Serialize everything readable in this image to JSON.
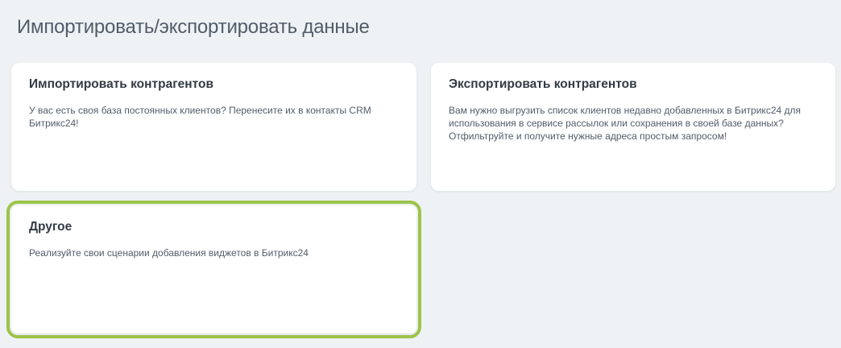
{
  "page": {
    "title": "Импортировать/экспортировать данные"
  },
  "cards": {
    "import": {
      "title": "Импортировать контрагентов",
      "description": "У вас есть своя база постоянных клиентов? Перенесите их в контакты CRM Битрикс24!"
    },
    "export": {
      "title": "Экспортировать контрагентов",
      "description": "Вам нужно выгрузить список клиентов недавно добавленных в Битрикс24 для использования в сервисе рассылок или сохранения в своей базе данных? Отфильтруйте и получите нужные адреса простым запросом!"
    },
    "other": {
      "title": "Другое",
      "description": "Реализуйте свои сценарии добавления виджетов в Битрикс24"
    }
  },
  "colors": {
    "background": "#eef2f4",
    "card": "#ffffff",
    "highlight": "#9dc34a",
    "title_text": "#525c69"
  }
}
